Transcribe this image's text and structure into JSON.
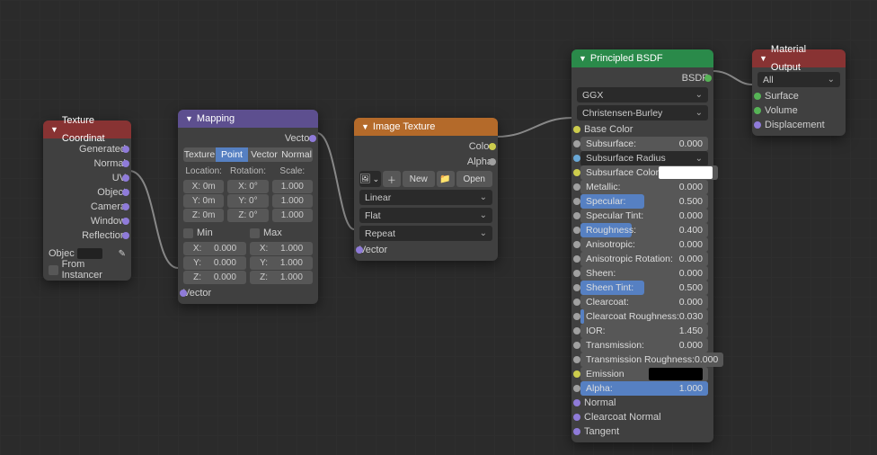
{
  "texcoord": {
    "title": "Texture Coordinat",
    "outputs": [
      "Generated",
      "Normal",
      "UV",
      "Object",
      "Camera",
      "Window",
      "Reflection"
    ],
    "object_label": "Objec",
    "from_instancer_label": "From Instancer"
  },
  "mapping": {
    "title": "Mapping",
    "out_label": "Vector",
    "type_options": [
      "Texture",
      "Point",
      "Vector",
      "Normal"
    ],
    "type_active": 1,
    "col_labels": [
      "Location:",
      "Rotation:",
      "Scale:"
    ],
    "rows": [
      {
        "axis": "X",
        "loc": "0m",
        "rot": "0°",
        "scale": "1.000"
      },
      {
        "axis": "Y",
        "loc": "0m",
        "rot": "0°",
        "scale": "1.000"
      },
      {
        "axis": "Z",
        "loc": "0m",
        "rot": "0°",
        "scale": "1.000"
      }
    ],
    "min_label": "Min",
    "max_label": "Max",
    "mins": [
      "0.000",
      "0.000",
      "0.000"
    ],
    "maxs": [
      "1.000",
      "1.000",
      "1.000"
    ],
    "in_label": "Vector"
  },
  "image": {
    "title": "Image Texture",
    "out_color": "Color",
    "out_alpha": "Alpha",
    "new_label": "New",
    "open_label": "Open",
    "interp": "Linear",
    "proj": "Flat",
    "extend": "Repeat",
    "in_vector": "Vector"
  },
  "bsdf": {
    "title": "Principled BSDF",
    "out": "BSDF",
    "distribution": "GGX",
    "sss_method": "Christensen-Burley",
    "props": [
      {
        "name": "Base Color",
        "type": "color",
        "sock": "yellow",
        "expand": true
      },
      {
        "name": "Subsurface:",
        "type": "num",
        "val": "0.000",
        "bar": 0
      },
      {
        "name": "Subsurface Radius",
        "type": "dropdown",
        "sock": "blue"
      },
      {
        "name": "Subsurface Color",
        "type": "color",
        "sock": "yellow",
        "swatch": "white"
      },
      {
        "name": "Metallic:",
        "type": "num",
        "val": "0.000",
        "bar": 0
      },
      {
        "name": "Specular:",
        "type": "num",
        "val": "0.500",
        "bar": 50
      },
      {
        "name": "Specular Tint:",
        "type": "num",
        "val": "0.000",
        "bar": 0
      },
      {
        "name": "Roughness:",
        "type": "num",
        "val": "0.400",
        "bar": 40
      },
      {
        "name": "Anisotropic:",
        "type": "num",
        "val": "0.000",
        "bar": 0
      },
      {
        "name": "Anisotropic Rotation:",
        "type": "num",
        "val": "0.000",
        "bar": 0
      },
      {
        "name": "Sheen:",
        "type": "num",
        "val": "0.000",
        "bar": 0
      },
      {
        "name": "Sheen Tint:",
        "type": "num",
        "val": "0.500",
        "bar": 50
      },
      {
        "name": "Clearcoat:",
        "type": "num",
        "val": "0.000",
        "bar": 0
      },
      {
        "name": "Clearcoat Roughness:",
        "type": "num",
        "val": "0.030",
        "bar": 3
      },
      {
        "name": "IOR:",
        "type": "num",
        "val": "1.450",
        "bar": 0
      },
      {
        "name": "Transmission:",
        "type": "num",
        "val": "0.000",
        "bar": 0
      },
      {
        "name": "Transmission Roughness:",
        "type": "num",
        "val": "0.000",
        "bar": 0
      },
      {
        "name": "Emission",
        "type": "color",
        "sock": "yellow",
        "swatch": "black"
      },
      {
        "name": "Alpha:",
        "type": "num",
        "val": "1.000",
        "bar": 100
      },
      {
        "name": "Normal",
        "type": "label",
        "sock": "purple"
      },
      {
        "name": "Clearcoat Normal",
        "type": "label",
        "sock": "purple"
      },
      {
        "name": "Tangent",
        "type": "label",
        "sock": "purple"
      }
    ]
  },
  "output": {
    "title": "Material Output",
    "target": "All",
    "inputs": [
      "Surface",
      "Volume",
      "Displacement"
    ]
  }
}
